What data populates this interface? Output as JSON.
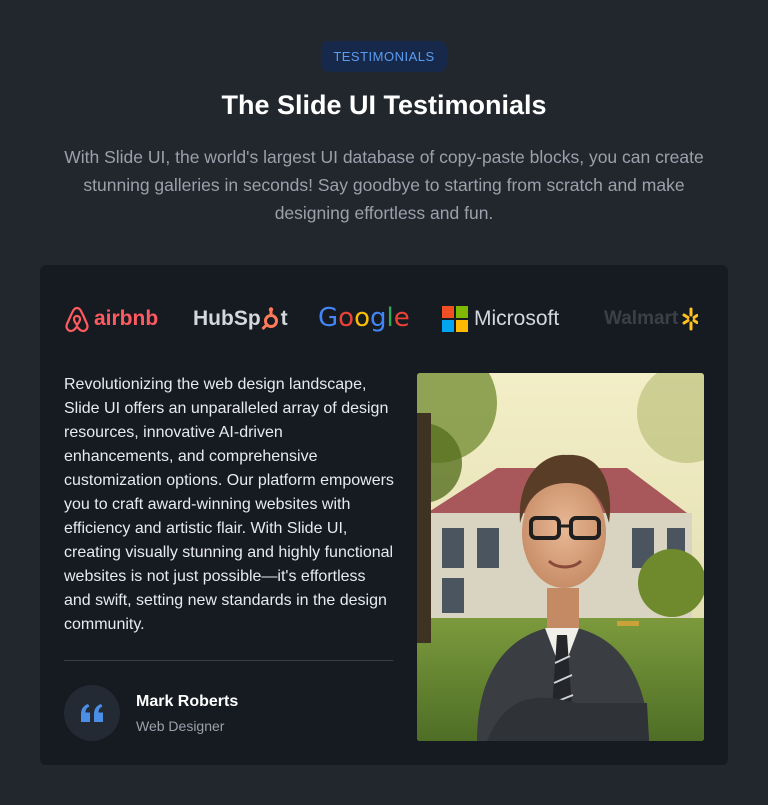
{
  "section": {
    "badge": "TESTIMONIALS",
    "title": "The Slide UI Testimonials",
    "subtitle": "With Slide UI, the world's largest UI database of copy-paste blocks, you can create stunning galleries in seconds! Say goodbye to starting from scratch and make designing effortless and fun."
  },
  "logos": [
    {
      "name": "airbnb",
      "text": "airbnb",
      "icon": "airbnb-icon"
    },
    {
      "name": "hubspot",
      "text": "HubSpot",
      "icon": "hubspot-icon"
    },
    {
      "name": "google",
      "text": "Google",
      "icon": "google-icon"
    },
    {
      "name": "microsoft",
      "text": "Microsoft",
      "icon": "microsoft-icon"
    },
    {
      "name": "walmart",
      "text": "Walmart",
      "icon": "walmart-spark-icon"
    }
  ],
  "testimonial": {
    "quote": "Revolutionizing the web design landscape, Slide UI offers an unparalleled array of design resources, innovative AI-driven enhancements, and comprehensive customization options. Our platform empowers you to craft award-winning websites with efficiency and artistic flair. With Slide UI, creating visually stunning and highly functional websites is not just possible—it's effortless and swift, setting new standards in the design community.",
    "author_name": "Mark Roberts",
    "author_role": "Web Designer",
    "quote_icon": "quote-mark-icon"
  },
  "colors": {
    "background": "#22272e",
    "card": "#161b22",
    "accent": "#5b9cf0",
    "airbnb": "#ff5a5f",
    "hubspot_accent": "#ff7a59",
    "google_blue": "#4285f4",
    "google_red": "#ea4335",
    "google_yellow": "#fbbc05",
    "google_green": "#34a853",
    "ms_red": "#f25022",
    "ms_green": "#7fba00",
    "ms_blue": "#00a4ef",
    "ms_yellow": "#ffb900",
    "walmart_spark": "#ffc220"
  }
}
